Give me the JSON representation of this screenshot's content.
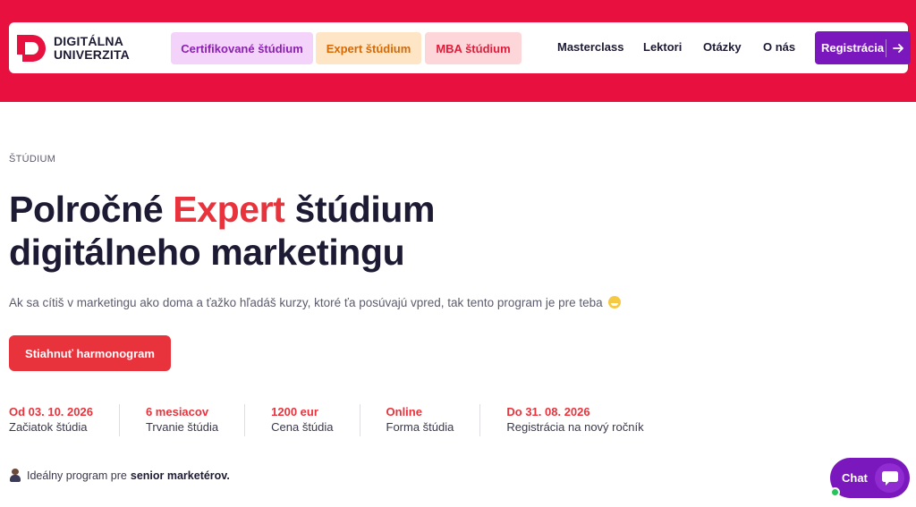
{
  "brand": {
    "name_line1": "DIGITÁLNA",
    "name_line2": "UNIVERZITA",
    "primary_color": "#e8103f",
    "accent_purple": "#7b18bd"
  },
  "nav": {
    "pills": [
      {
        "label": "Certifikované štúdium"
      },
      {
        "label": "Expert štúdium"
      },
      {
        "label": "MBA štúdium"
      }
    ],
    "links": [
      {
        "label": "Masterclass"
      },
      {
        "label": "Lektori"
      },
      {
        "label": "Otázky"
      },
      {
        "label": "O nás"
      }
    ],
    "register_label": "Registrácia",
    "register_icon": "arrow-right-icon"
  },
  "hero": {
    "eyebrow": "ŠTÚDIUM",
    "title_part1": "Polročné ",
    "title_accent": "Expert",
    "title_part2": " štúdium",
    "title_line2": "digitálneho marketingu",
    "lead": "Ak sa cítiš v marketingu ako doma a ťažko hľadáš kurzy, ktoré ťa posúvajú vpred, tak tento program je pre teba",
    "lead_icon": "grinning-face-emoji",
    "cta_label": "Stiahnuť harmonogram"
  },
  "stats": [
    {
      "value": "Od 03. 10. 2026",
      "label": "Začiatok štúdia"
    },
    {
      "value": "6 mesiacov",
      "label": "Trvanie štúdia"
    },
    {
      "value": "1200 eur",
      "label": "Cena štúdia"
    },
    {
      "value": "Online",
      "label": "Forma štúdia"
    },
    {
      "value": "Do 31. 08. 2026",
      "label": "Registrácia na nový ročník"
    }
  ],
  "ideal": {
    "icon": "person-icon",
    "text": "Ideálny program pre",
    "strong": "senior marketérov."
  },
  "chat": {
    "label": "Chat",
    "icon": "chat-bubble-icon",
    "status_color": "#26c55a"
  }
}
